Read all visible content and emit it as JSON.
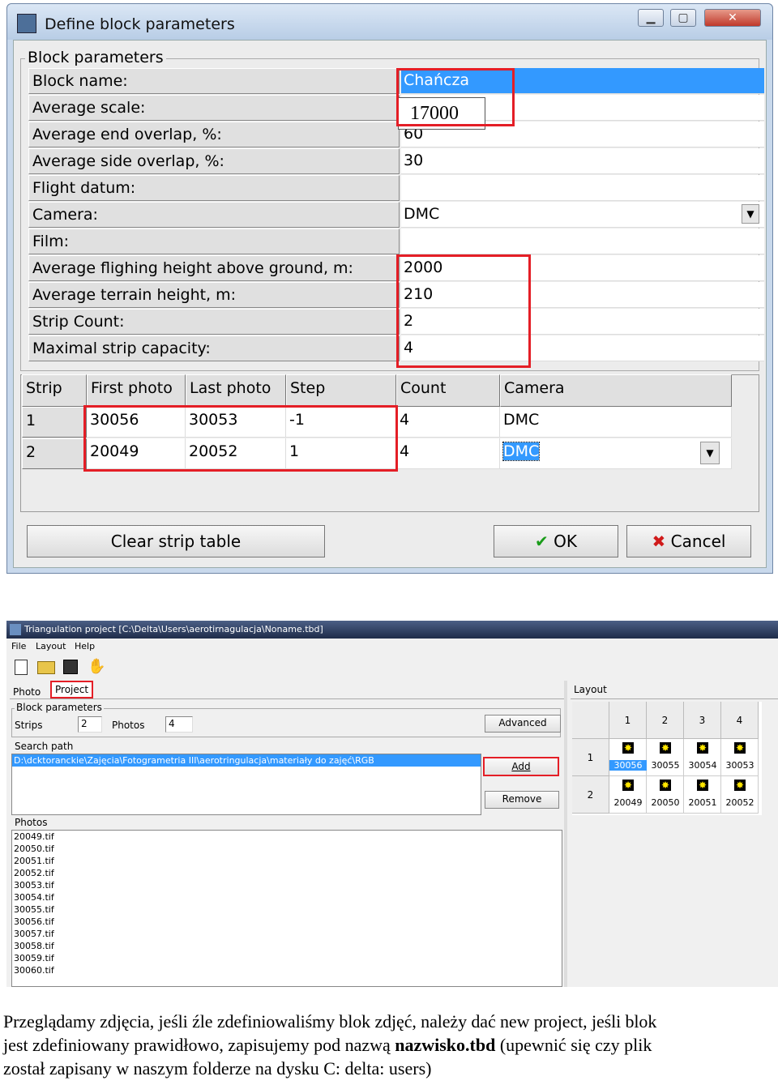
{
  "dialog1": {
    "title": "Define block parameters",
    "group_title": "Block parameters",
    "params": [
      {
        "label": "Block name:",
        "value": "Chańcza"
      },
      {
        "label": "Average scale:",
        "value": ""
      },
      {
        "label": "Average end overlap, %:",
        "value": "60"
      },
      {
        "label": "Average side overlap, %:",
        "value": "30"
      },
      {
        "label": "Flight datum:",
        "value": ""
      },
      {
        "label": "Camera:",
        "value": "DMC"
      },
      {
        "label": "Film:",
        "value": ""
      },
      {
        "label": "Average flighing height above ground, m:",
        "value": "2000"
      },
      {
        "label": "Average terrain height, m:",
        "value": "210"
      },
      {
        "label": "Strip Count:",
        "value": "2"
      },
      {
        "label": "Maximal strip capacity:",
        "value": "4"
      }
    ],
    "scale_overlay": "17000",
    "strip_table": {
      "headers": [
        "Strip",
        "First photo",
        "Last photo",
        "Step",
        "Count",
        "Camera"
      ],
      "rows": [
        [
          "1",
          "30056",
          "30053",
          "-1",
          "4",
          "DMC"
        ],
        [
          "2",
          "20049",
          "20052",
          "1",
          "4",
          "DMC"
        ]
      ]
    },
    "buttons": {
      "clear": "Clear strip table",
      "ok": "OK",
      "cancel": "Cancel"
    },
    "colors": {
      "highlight": "#e41e26",
      "selection": "#3399ff"
    }
  },
  "dialog2": {
    "title": "Triangulation project [C:\\Delta\\Users\\aerotirnagulacja\\Noname.tbd]",
    "menu": [
      "File",
      "Layout",
      "Help"
    ],
    "tabs": [
      "Photo",
      "Project"
    ],
    "layout_tab": "Layout",
    "block_group": "Block parameters",
    "strips_label": "Strips",
    "strips_value": "2",
    "photos_label": "Photos",
    "photos_value": "4",
    "advanced": "Advanced",
    "search_group": "Search path",
    "search_path": "D:\\dcktoranckie\\Zajęcia\\Fotogrametria III\\aerotringulacja\\materiały do zajęć\\RGB",
    "add": "Add",
    "remove": "Remove",
    "photos_group": "Photos",
    "photos_list": [
      "20049.tif",
      "20050.tif",
      "20051.tif",
      "20052.tif",
      "30053.tif",
      "30054.tif",
      "30055.tif",
      "30056.tif",
      "30057.tif",
      "30058.tif",
      "30059.tif",
      "30060.tif"
    ],
    "grid_cols": [
      "1",
      "2",
      "3",
      "4"
    ],
    "grid_rows": [
      {
        "label": "1",
        "photos": [
          "30056",
          "30055",
          "30054",
          "30053"
        ]
      },
      {
        "label": "2",
        "photos": [
          "20049",
          "20050",
          "20051",
          "20052"
        ]
      }
    ]
  },
  "caption": {
    "line1": "Przeglądamy zdjęcia, jeśli źle zdefiniowaliśmy blok zdjęć, należy dać new project, jeśli blok",
    "line2_a": "jest zdefiniowany prawidłowo, zapisujemy pod nazwą ",
    "line2_bold": "nazwisko.tbd",
    "line2_b": " (upewnić się czy plik",
    "line3": "został zapisany w naszym folderze na dysku C: delta: users)"
  }
}
